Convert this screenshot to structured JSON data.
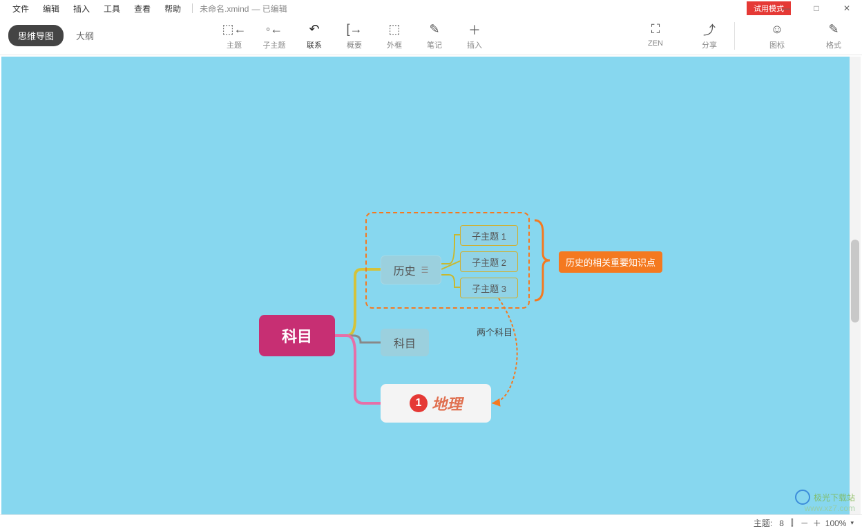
{
  "menu": {
    "items": [
      "文件",
      "编辑",
      "插入",
      "工具",
      "查看",
      "帮助"
    ],
    "filename": "未命名.xmind",
    "status": "— 已编辑"
  },
  "trial": "试用模式",
  "window": {
    "minimize": "—",
    "maximize": "□",
    "close": "✕"
  },
  "view": {
    "mindmap": "思维导图",
    "outline": "大纲"
  },
  "tools": [
    {
      "icon": "⬚←",
      "label": "主题"
    },
    {
      "icon": "◦←",
      "label": "子主题"
    },
    {
      "icon": "↶",
      "label": "联系"
    },
    {
      "icon": "[→",
      "label": "概要"
    },
    {
      "icon": "⬚",
      "label": "外框"
    },
    {
      "icon": "✎",
      "label": "笔记"
    },
    {
      "icon": "＋",
      "label": "插入"
    }
  ],
  "right_tools": [
    {
      "icon": "⛶",
      "label": "ZEN"
    },
    {
      "icon": "⤴",
      "label": "分享"
    }
  ],
  "far_right": [
    {
      "icon": "☺",
      "label": "图标"
    },
    {
      "icon": "✎",
      "label": "格式"
    }
  ],
  "map": {
    "central": "科目",
    "history": "历史",
    "subject": "科目",
    "geo": {
      "num": "1",
      "text": "地理"
    },
    "subtopics": [
      "子主题 1",
      "子主题 2",
      "子主题 3"
    ],
    "summary": "历史的相关重要知识点",
    "relationship": "两个科目"
  },
  "status": {
    "topic_label": "主题:",
    "topic_count": "8",
    "zoom_out": "－",
    "zoom_in": "＋",
    "zoom": "100%",
    "book": "⫿"
  },
  "watermark": {
    "line1": "极光下载站",
    "line2": "www.xz7.com"
  }
}
